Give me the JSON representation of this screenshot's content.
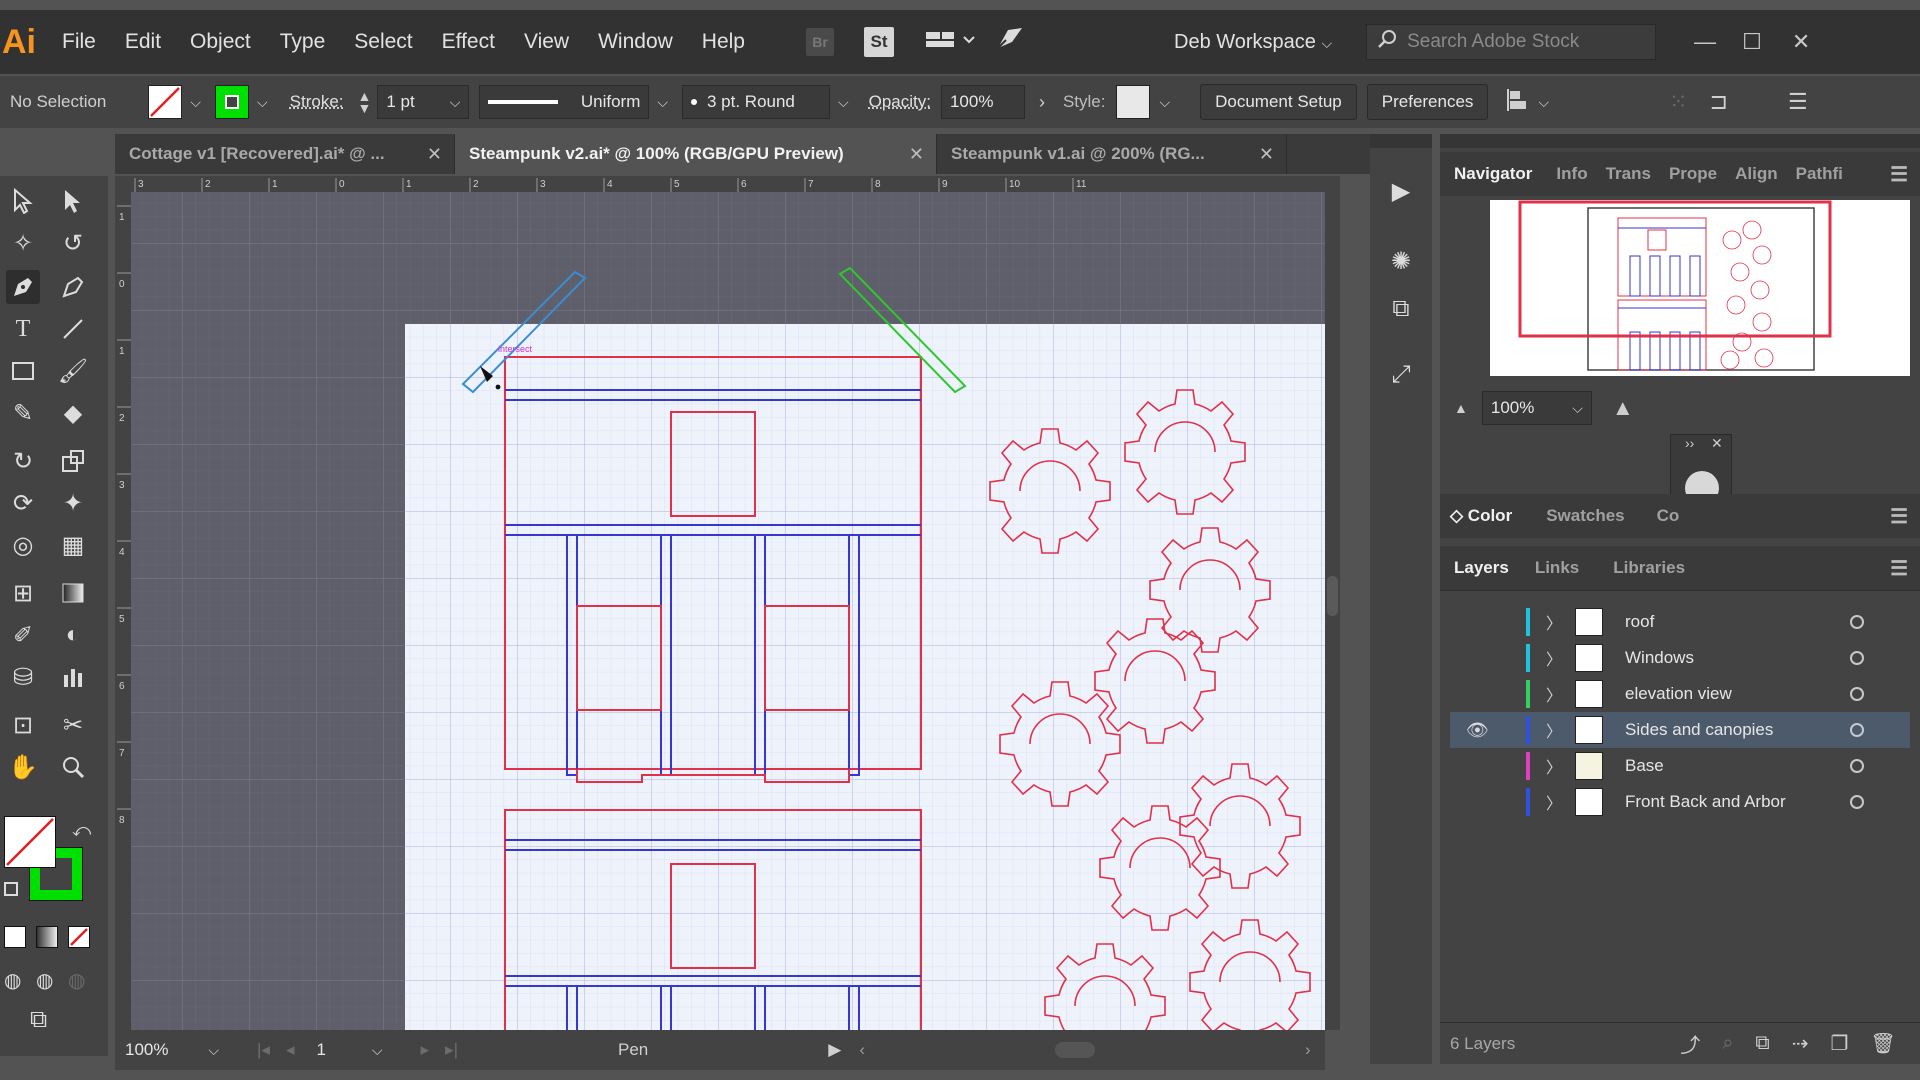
{
  "app": {
    "logo": "Ai"
  },
  "menu": [
    "File",
    "Edit",
    "Object",
    "Type",
    "Select",
    "Effect",
    "View",
    "Window",
    "Help"
  ],
  "menubar": {
    "br": "Br",
    "st": "St",
    "workspace": "Deb Workspace",
    "search_placeholder": "Search Adobe Stock"
  },
  "control": {
    "selection": "No Selection",
    "stroke_label": "Stroke:",
    "stroke_weight": "1 pt",
    "profile": "Uniform",
    "brush": "3 pt. Round",
    "opacity_label": "Opacity:",
    "opacity": "100%",
    "style_label": "Style:",
    "doc_setup": "Document Setup",
    "preferences": "Preferences",
    "fill_color": "#ffffff",
    "stroke_color": "#00e000"
  },
  "tabs": [
    {
      "label": "Cottage v1 [Recovered].ai* @ ...",
      "active": false
    },
    {
      "label": "Steampunk v2.ai* @ 100% (RGB/GPU Preview)",
      "active": true
    },
    {
      "label": "Steampunk v1.ai @ 200% (RG...",
      "active": false
    }
  ],
  "ruler": {
    "top_ticks": [
      "3",
      "2",
      "1",
      "0",
      "1",
      "2",
      "3",
      "4",
      "5",
      "6",
      "7",
      "8",
      "9",
      "10",
      "11"
    ],
    "left_ticks": [
      "1",
      "0",
      "1",
      "2",
      "3",
      "4",
      "5",
      "6",
      "7",
      "8"
    ]
  },
  "canvas": {
    "smart_guide": "intersect"
  },
  "status": {
    "zoom": "100%",
    "artboard": "1",
    "tool": "Pen"
  },
  "right_panel": {
    "nav_tabs": [
      "Navigator",
      "Info",
      "Trans",
      "Prope",
      "Align",
      "Pathfi"
    ],
    "nav_zoom": "100%",
    "color_tabs": [
      "Color",
      "Swatches",
      "Co"
    ],
    "layer_tabs": [
      "Layers",
      "Links",
      "Libraries"
    ],
    "layers": [
      {
        "name": "roof",
        "color": "#20c0e0",
        "visible": false,
        "selected": false
      },
      {
        "name": "Windows",
        "color": "#20c0e0",
        "visible": false,
        "selected": false
      },
      {
        "name": "elevation view",
        "color": "#30d060",
        "visible": false,
        "selected": false
      },
      {
        "name": "Sides and canopies",
        "color": "#3050e0",
        "visible": true,
        "selected": true
      },
      {
        "name": "Base",
        "color": "#e040c0",
        "visible": false,
        "selected": false
      },
      {
        "name": "Front Back and Arbor",
        "color": "#3050e0",
        "visible": false,
        "selected": false
      }
    ],
    "layer_count": "6 Layers"
  }
}
